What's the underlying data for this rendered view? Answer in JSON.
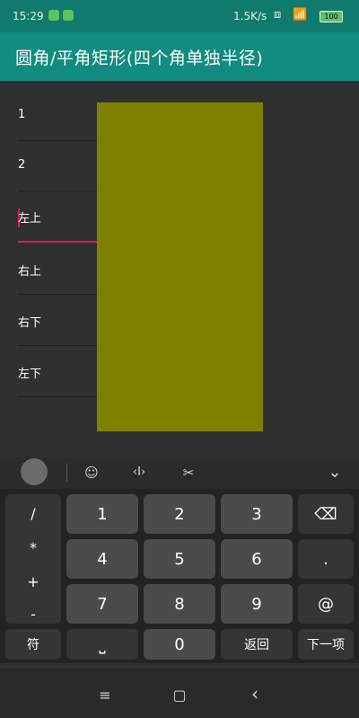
{
  "status_bar": {
    "time": "15:29",
    "net_speed": "1.5K/s",
    "battery_level": "100",
    "accent_color": "#5ec35e"
  },
  "app_bar": {
    "title": "圆角/平角矩形(四个角单独半径)",
    "color": "#128c7e"
  },
  "form": {
    "fields": [
      {
        "label": "1"
      },
      {
        "label": "2"
      },
      {
        "label": "左上",
        "focused": true
      },
      {
        "label": "右上"
      },
      {
        "label": "右下"
      },
      {
        "label": "左下"
      }
    ],
    "preview_color": "#808000"
  },
  "ime_toolbar": {
    "icons": [
      "avatar-icon",
      "emoji-icon",
      "text-cursor-icon",
      "clipboard-scissors-icon",
      "chevron-down-icon"
    ],
    "emoji_glyph": "☺",
    "cursor_glyph": "‹I›",
    "clip_glyph": "✂",
    "collapse_glyph": "⌄"
  },
  "keyboard": {
    "symbols": [
      "/",
      "*",
      "+",
      "-"
    ],
    "row1": [
      "1",
      "2",
      "3"
    ],
    "row2": [
      "4",
      "5",
      "6"
    ],
    "row3": [
      "7",
      "8",
      "9"
    ],
    "backspace_glyph": "⌫",
    "dot": ".",
    "at": "@",
    "symbol_key": "符",
    "space_glyph": "⎵",
    "zero": "0",
    "back_key": "返回",
    "next_key": "下一项"
  },
  "nav_bar": {
    "menu_glyph": "≡",
    "home_glyph": "▢",
    "back_glyph": "‹"
  }
}
